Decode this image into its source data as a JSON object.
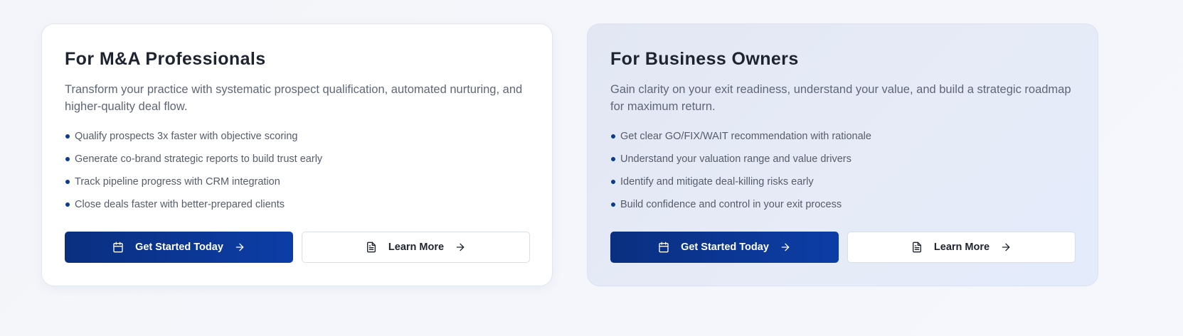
{
  "cards": [
    {
      "title": "For M&A Professionals",
      "description": "Transform your practice with systematic prospect qualification, automated nurturing, and higher-quality deal flow.",
      "bullets": [
        "Qualify prospects 3x faster with objective scoring",
        "Generate co-brand strategic reports to build trust early",
        "Track pipeline progress with CRM integration",
        "Close deals faster with better-prepared clients"
      ],
      "primary_label": "Get Started Today",
      "secondary_label": "Learn More"
    },
    {
      "title": "For Business Owners",
      "description": "Gain clarity on your exit readiness, understand your value, and build a strategic roadmap for maximum return.",
      "bullets": [
        "Get clear GO/FIX/WAIT recommendation with rationale",
        "Understand your valuation range and value drivers",
        "Identify and mitigate deal-killing risks early",
        "Build confidence and control in your exit process"
      ],
      "primary_label": "Get Started Today",
      "secondary_label": "Learn More"
    }
  ],
  "icons": {
    "primary_lead": "calendar-icon",
    "secondary_lead": "document-icon",
    "trail": "arrow-right-icon"
  },
  "colors": {
    "accent": "#0b3a93",
    "primary_button_start": "#0a2f80",
    "primary_button_end": "#0c3da6",
    "title_text": "#1e2330",
    "body_text": "#5f6677"
  }
}
